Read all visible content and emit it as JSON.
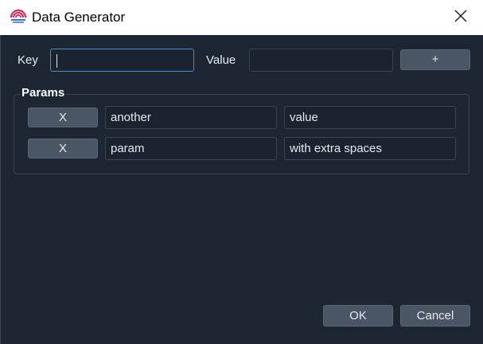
{
  "window": {
    "title": "Data Generator"
  },
  "entry": {
    "key_label": "Key",
    "key_value": "",
    "value_label": "Value",
    "value_value": "",
    "add_label": "+"
  },
  "params": {
    "title": "Params",
    "rows": [
      {
        "remove_label": "X",
        "key": "another",
        "value": "value"
      },
      {
        "remove_label": "X",
        "key": "param",
        "value": "with extra spaces"
      }
    ]
  },
  "footer": {
    "ok_label": "OK",
    "cancel_label": "Cancel"
  },
  "icons": {
    "app": "data-generator-icon",
    "close": "close-icon"
  },
  "colors": {
    "background": "#1c2733",
    "input_bg": "#1a2430",
    "button_bg": "#4a5663",
    "focus_border": "#4a90c8"
  }
}
